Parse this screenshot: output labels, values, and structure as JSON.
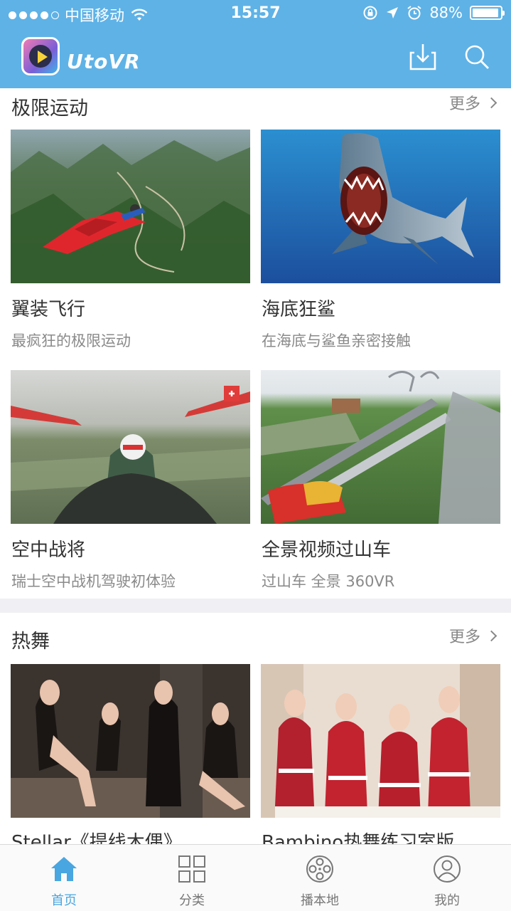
{
  "status": {
    "carrier": "中国移动",
    "time": "15:57",
    "battery": "88%"
  },
  "header": {
    "brand": "UtoVR",
    "icons": [
      "download-icon",
      "search-icon"
    ]
  },
  "sections": [
    {
      "title": "极限运动",
      "more": "更多",
      "items": [
        {
          "title": "翼装飞行",
          "subtitle": "最疯狂的极限运动"
        },
        {
          "title": "海底狂鲨",
          "subtitle": "在海底与鲨鱼亲密接触"
        },
        {
          "title": "空中战将",
          "subtitle": "瑞士空中战机驾驶初体验"
        },
        {
          "title": "全景视频过山车",
          "subtitle": "过山车 全景 360VR"
        }
      ]
    },
    {
      "title": "热舞",
      "more": "更多",
      "items": [
        {
          "title": "Stellar《提线木偶》"
        },
        {
          "title": "Bambino热舞练习室版"
        }
      ]
    }
  ],
  "tabbar": [
    {
      "label": "首页",
      "icon": "home-icon",
      "active": true
    },
    {
      "label": "分类",
      "icon": "grid-icon",
      "active": false
    },
    {
      "label": "播本地",
      "icon": "film-reel-icon",
      "active": false
    },
    {
      "label": "我的",
      "icon": "user-icon",
      "active": false
    }
  ],
  "colors": {
    "brand_blue": "#5fb2e6",
    "active_tab": "#49a6e0"
  }
}
